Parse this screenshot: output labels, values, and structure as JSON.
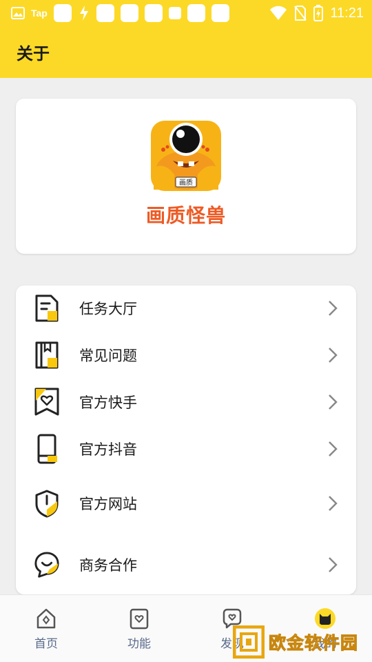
{
  "status_bar": {
    "tap_label": "Tap",
    "time": "11:21"
  },
  "app_bar": {
    "title": "关于"
  },
  "app_info": {
    "logo_badge": "画质",
    "name": "画质怪兽"
  },
  "menu": {
    "items": [
      {
        "label": "任务大厅",
        "icon": "document-icon"
      },
      {
        "label": "常见问题",
        "icon": "book-icon"
      },
      {
        "label": "官方快手",
        "icon": "heart-tag-icon"
      },
      {
        "label": "官方抖音",
        "icon": "phone-icon"
      },
      {
        "label": "官方网站",
        "icon": "shield-icon"
      },
      {
        "label": "商务合作",
        "icon": "chat-bubble-icon"
      }
    ]
  },
  "bottom_nav": {
    "items": [
      {
        "label": "首页",
        "icon": "home-icon"
      },
      {
        "label": "功能",
        "icon": "heart-card-icon"
      },
      {
        "label": "发现",
        "icon": "message-heart-icon"
      },
      {
        "label": "我的",
        "icon": "cat-icon"
      }
    ]
  },
  "watermark": {
    "text": "欧金软件园",
    "url": "www.apoujin.com"
  },
  "colors": {
    "brand_yellow": "#fcd926",
    "app_name": "#ee5a24",
    "nav_label": "#5a6a8a"
  }
}
